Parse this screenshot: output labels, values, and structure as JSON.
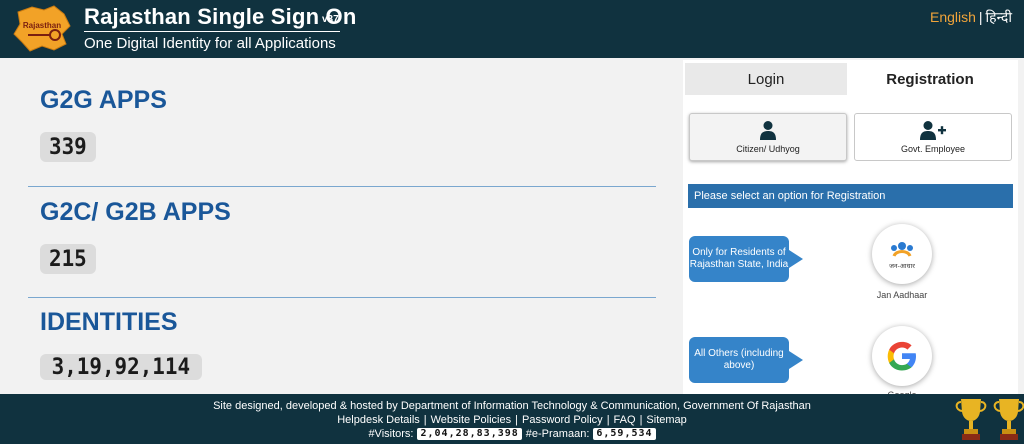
{
  "header": {
    "title": "Rajasthan Single Sign On",
    "version": "v37",
    "tagline": "One Digital Identity for all Applications",
    "logo_text": "Rajasthan",
    "lang_en": "English",
    "lang_sep": "|",
    "lang_hi": "हिन्दी"
  },
  "stats": [
    {
      "label": "G2G APPS",
      "value": "339"
    },
    {
      "label": "G2C/ G2B APPS",
      "value": "215"
    },
    {
      "label": "IDENTITIES",
      "value": "3,19,92,114"
    }
  ],
  "tabs": {
    "login": "Login",
    "registration": "Registration"
  },
  "options": {
    "citizen": "Citizen/ Udhyog",
    "govt": "Govt. Employee"
  },
  "notice": "Please select an option for Registration",
  "providers": {
    "jan_bubble": "Only for Residents of Rajasthan State, India",
    "jan_caption": "Jan Aadhaar",
    "jan_logo_text": "जन-आधार",
    "google_bubble": "All Others (including above)",
    "google_caption": "Google"
  },
  "footer": {
    "line1": "Site designed, developed & hosted by Department of Information Technology & Communication, Government Of Rajasthan",
    "links": [
      "Helpdesk Details",
      "Website Policies",
      "Password Policy",
      "FAQ",
      "Sitemap"
    ],
    "visitors_label": "#Visitors:",
    "visitors_value": "2,04,28,83,398",
    "epramaan_label": "#e-Pramaan:",
    "epramaan_value": "6,59,534"
  },
  "colors": {
    "header_bg": "#10323f",
    "accent_blue": "#1a5799",
    "lang_en": "#f0a43a",
    "notice_bg": "#2a6fab"
  }
}
